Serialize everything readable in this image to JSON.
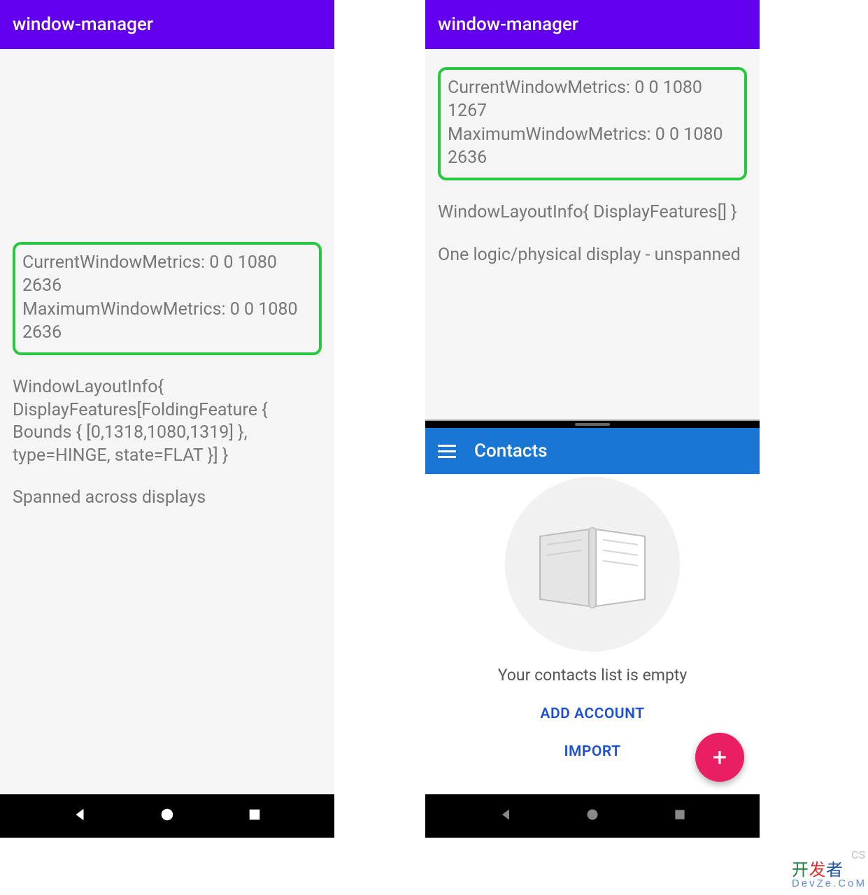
{
  "left": {
    "appbar_title": "window-manager",
    "metrics": {
      "current": "CurrentWindowMetrics: 0 0 1080 2636",
      "maximum": "MaximumWindowMetrics: 0 0 1080 2636"
    },
    "layout_info": "WindowLayoutInfo{ DisplayFeatures[FoldingFeature { Bounds { [0,1318,1080,1319] }, type=HINGE, state=FLAT }] }",
    "span_state": "Spanned across displays"
  },
  "right": {
    "appbar_title": "window-manager",
    "metrics": {
      "current": "CurrentWindowMetrics: 0 0 1080 1267",
      "maximum": "MaximumWindowMetrics: 0 0 1080 2636"
    },
    "layout_info": "WindowLayoutInfo{ DisplayFeatures[] }",
    "span_state": "One logic/physical display - unspanned",
    "contacts": {
      "title": "Contacts",
      "empty_message": "Your contacts list is empty",
      "add_account_label": "ADD ACCOUNT",
      "import_label": "IMPORT",
      "fab_label": "+"
    }
  },
  "watermark": {
    "cs": "CS",
    "brand_line1_a": "开",
    "brand_line1_b": "发",
    "brand_line1_c": "者",
    "brand_line2": "DevZe.CoM"
  }
}
